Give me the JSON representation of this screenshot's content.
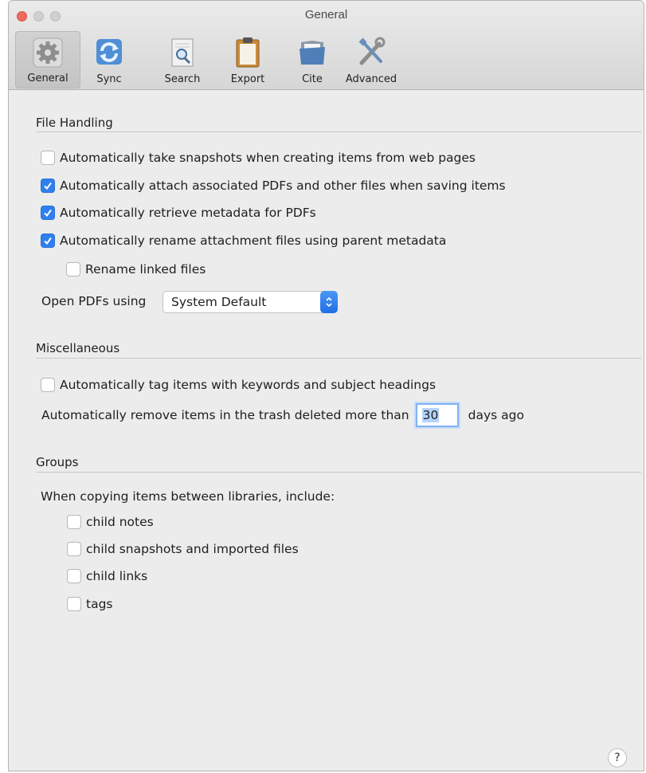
{
  "window": {
    "title": "General"
  },
  "toolbar": {
    "tabs": [
      {
        "label": "General",
        "icon": "gear-icon",
        "active": true
      },
      {
        "label": "Sync",
        "icon": "sync-icon"
      },
      {
        "label": "Search",
        "icon": "search-icon"
      },
      {
        "label": "Export",
        "icon": "clipboard-icon"
      },
      {
        "label": "Cite",
        "icon": "folder-icon"
      },
      {
        "label": "Advanced",
        "icon": "tools-icon"
      }
    ]
  },
  "file_handling": {
    "title": "File Handling",
    "snapshots": {
      "label": "Automatically take snapshots when creating items from web pages",
      "checked": false
    },
    "attach_pdfs": {
      "label": "Automatically attach associated PDFs and other files when saving items",
      "checked": true
    },
    "retrieve_metadata": {
      "label": "Automatically retrieve metadata for PDFs",
      "checked": true
    },
    "rename_attachments": {
      "label": "Automatically rename attachment files using parent metadata",
      "checked": true
    },
    "rename_linked": {
      "label": "Rename linked files",
      "checked": false
    },
    "open_pdfs_label": "Open PDFs using",
    "open_pdfs_value": "System Default"
  },
  "misc": {
    "title": "Miscellaneous",
    "auto_tag": {
      "label": "Automatically tag items with keywords and subject headings",
      "checked": false
    },
    "trash_prefix": "Automatically remove items in the trash deleted more than",
    "trash_days": "30",
    "trash_suffix": "days ago"
  },
  "groups": {
    "title": "Groups",
    "intro": "When copying items between libraries, include:",
    "child_notes": {
      "label": "child notes",
      "checked": false
    },
    "child_snapshots": {
      "label": "child snapshots and imported files",
      "checked": false
    },
    "child_links": {
      "label": "child links",
      "checked": false
    },
    "tags": {
      "label": "tags",
      "checked": false
    }
  },
  "help_label": "?",
  "colors": {
    "accent": "#2f80ee",
    "close": "#ee6a5f"
  }
}
